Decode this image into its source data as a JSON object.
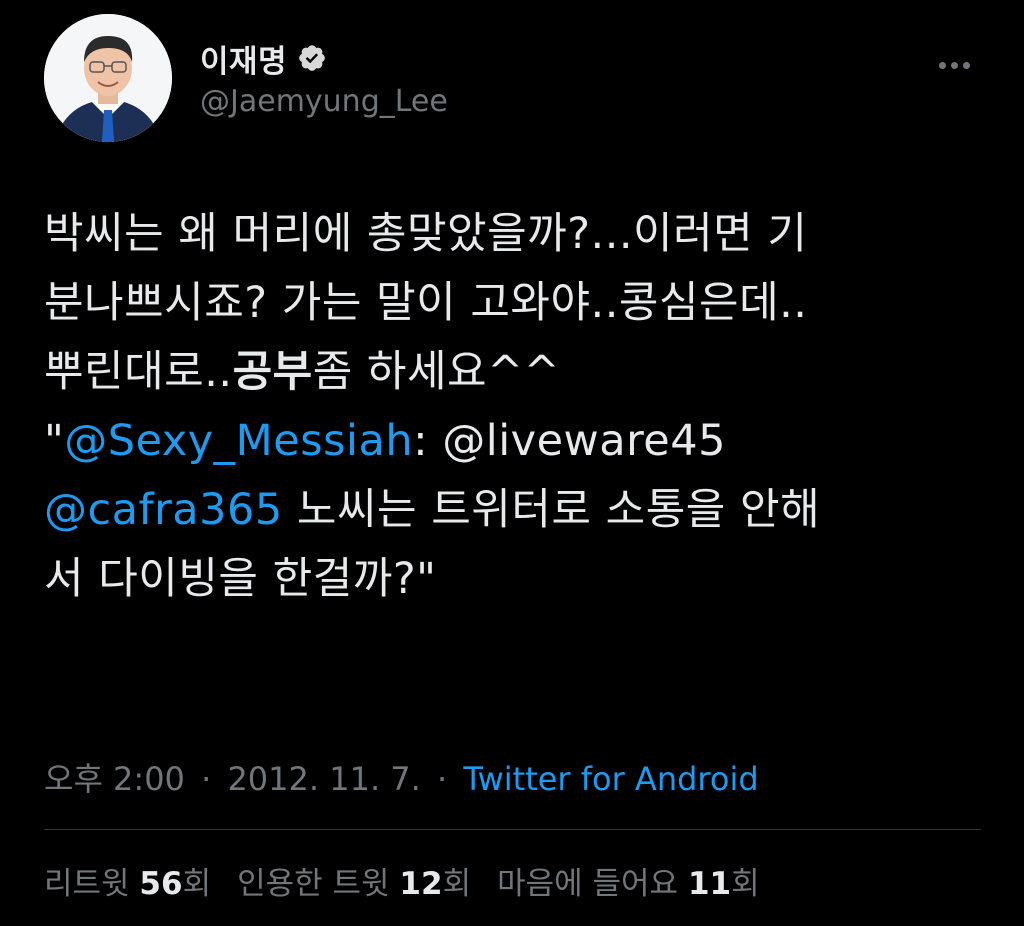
{
  "colors": {
    "background": "#000000",
    "text_primary": "#e7e9ea",
    "text_secondary": "#71767b",
    "link": "#1d9bf0",
    "divider": "#2f3336"
  },
  "author": {
    "display_name": "이재명",
    "handle": "@Jaemyung_Lee",
    "verified_icon": "verified-badge-icon",
    "avatar_icon": "profile-photo"
  },
  "more_icon": "more-options-icon",
  "tweet": {
    "line1": "박씨는 왜 머리에 총맞았을까?...이러면 기",
    "line2": "분나쁘시죠? 가는 말이 고와야..콩심은데..",
    "line3_pre": "뿌린대로..",
    "line3_bold": "공부",
    "line3_post": "좀 하세요^^",
    "line4_quote_open": "\"",
    "line4_mention": "@Sexy_Messiah",
    "line4_rest": ": @liveware45",
    "line5_mention": "@cafra365",
    "line5_rest": " 노씨는 트위터로 소통을 안해",
    "line6": "서 다이빙을 한걸까?\""
  },
  "meta": {
    "time": "오후 2:00",
    "separator": "·",
    "date": "2012. 11. 7.",
    "source": "Twitter for Android"
  },
  "stats": {
    "retweets_label": "리트윗",
    "retweets_count": "56",
    "retweets_suffix": "회",
    "quotes_label": "인용한 트윗",
    "quotes_count": "12",
    "quotes_suffix": "회",
    "likes_label": "마음에 들어요",
    "likes_count": "11",
    "likes_suffix": "회"
  }
}
